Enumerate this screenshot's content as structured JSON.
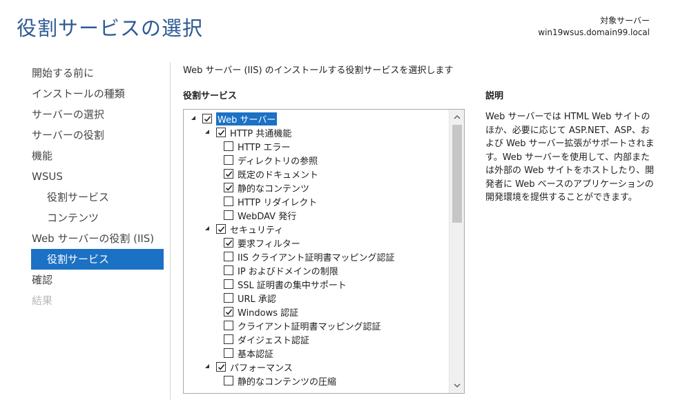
{
  "header": {
    "title": "役割サービスの選択",
    "target_label": "対象サーバー",
    "target_server": "win19wsus.domain99.local"
  },
  "nav": {
    "items": [
      {
        "label": "開始する前に",
        "state": "normal",
        "level": 0
      },
      {
        "label": "インストールの種類",
        "state": "normal",
        "level": 0
      },
      {
        "label": "サーバーの選択",
        "state": "normal",
        "level": 0
      },
      {
        "label": "サーバーの役割",
        "state": "normal",
        "level": 0
      },
      {
        "label": "機能",
        "state": "normal",
        "level": 0
      },
      {
        "label": "WSUS",
        "state": "normal",
        "level": 0
      },
      {
        "label": "役割サービス",
        "state": "normal",
        "level": 1
      },
      {
        "label": "コンテンツ",
        "state": "normal",
        "level": 1
      },
      {
        "label": "Web サーバーの役割 (IIS)",
        "state": "normal",
        "level": 0
      },
      {
        "label": "役割サービス",
        "state": "active",
        "level": 1
      },
      {
        "label": "確認",
        "state": "normal",
        "level": 0
      },
      {
        "label": "結果",
        "state": "disabled",
        "level": 0
      }
    ]
  },
  "main": {
    "instruction": "Web サーバー (IIS) のインストールする役割サービスを選択します",
    "section_label": "役割サービス",
    "description_label": "説明",
    "description_text": "Web サーバーでは HTML Web サイトのほか、必要に応じて ASP.NET、ASP、および Web サーバー拡張がサポートされます。Web サーバーを使用して、内部または外部の Web サイトをホストしたり、開発者に Web ベースのアプリケーションの開発環境を提供することができます。"
  },
  "tree": [
    {
      "label": "Web サーバー",
      "level": 0,
      "checked": true,
      "expanded": true,
      "selected": true
    },
    {
      "label": "HTTP 共通機能",
      "level": 1,
      "checked": true,
      "expanded": true
    },
    {
      "label": "HTTP エラー",
      "level": 2,
      "checked": false
    },
    {
      "label": "ディレクトリの参照",
      "level": 2,
      "checked": false
    },
    {
      "label": "既定のドキュメント",
      "level": 2,
      "checked": true
    },
    {
      "label": "静的なコンテンツ",
      "level": 2,
      "checked": true
    },
    {
      "label": "HTTP リダイレクト",
      "level": 2,
      "checked": false
    },
    {
      "label": "WebDAV 発行",
      "level": 2,
      "checked": false
    },
    {
      "label": "セキュリティ",
      "level": 1,
      "checked": true,
      "expanded": true
    },
    {
      "label": "要求フィルター",
      "level": 2,
      "checked": true
    },
    {
      "label": "IIS クライアント証明書マッピング認証",
      "level": 2,
      "checked": false
    },
    {
      "label": "IP およびドメインの制限",
      "level": 2,
      "checked": false
    },
    {
      "label": "SSL 証明書の集中サポート",
      "level": 2,
      "checked": false
    },
    {
      "label": "URL 承認",
      "level": 2,
      "checked": false
    },
    {
      "label": "Windows 認証",
      "level": 2,
      "checked": true
    },
    {
      "label": "クライアント証明書マッピング認証",
      "level": 2,
      "checked": false
    },
    {
      "label": "ダイジェスト認証",
      "level": 2,
      "checked": false
    },
    {
      "label": "基本認証",
      "level": 2,
      "checked": false
    },
    {
      "label": "パフォーマンス",
      "level": 1,
      "checked": true,
      "expanded": true
    },
    {
      "label": "静的なコンテンツの圧縮",
      "level": 2,
      "checked": false
    }
  ],
  "icons": {
    "expanded": "triangle-down-right-icon",
    "check": "checkmark-icon",
    "scroll_up": "chevron-up-icon",
    "scroll_down": "chevron-down-icon"
  },
  "colors": {
    "title": "#2d5a93",
    "accent": "#1b71c4",
    "disabled": "#b8b8b8"
  }
}
